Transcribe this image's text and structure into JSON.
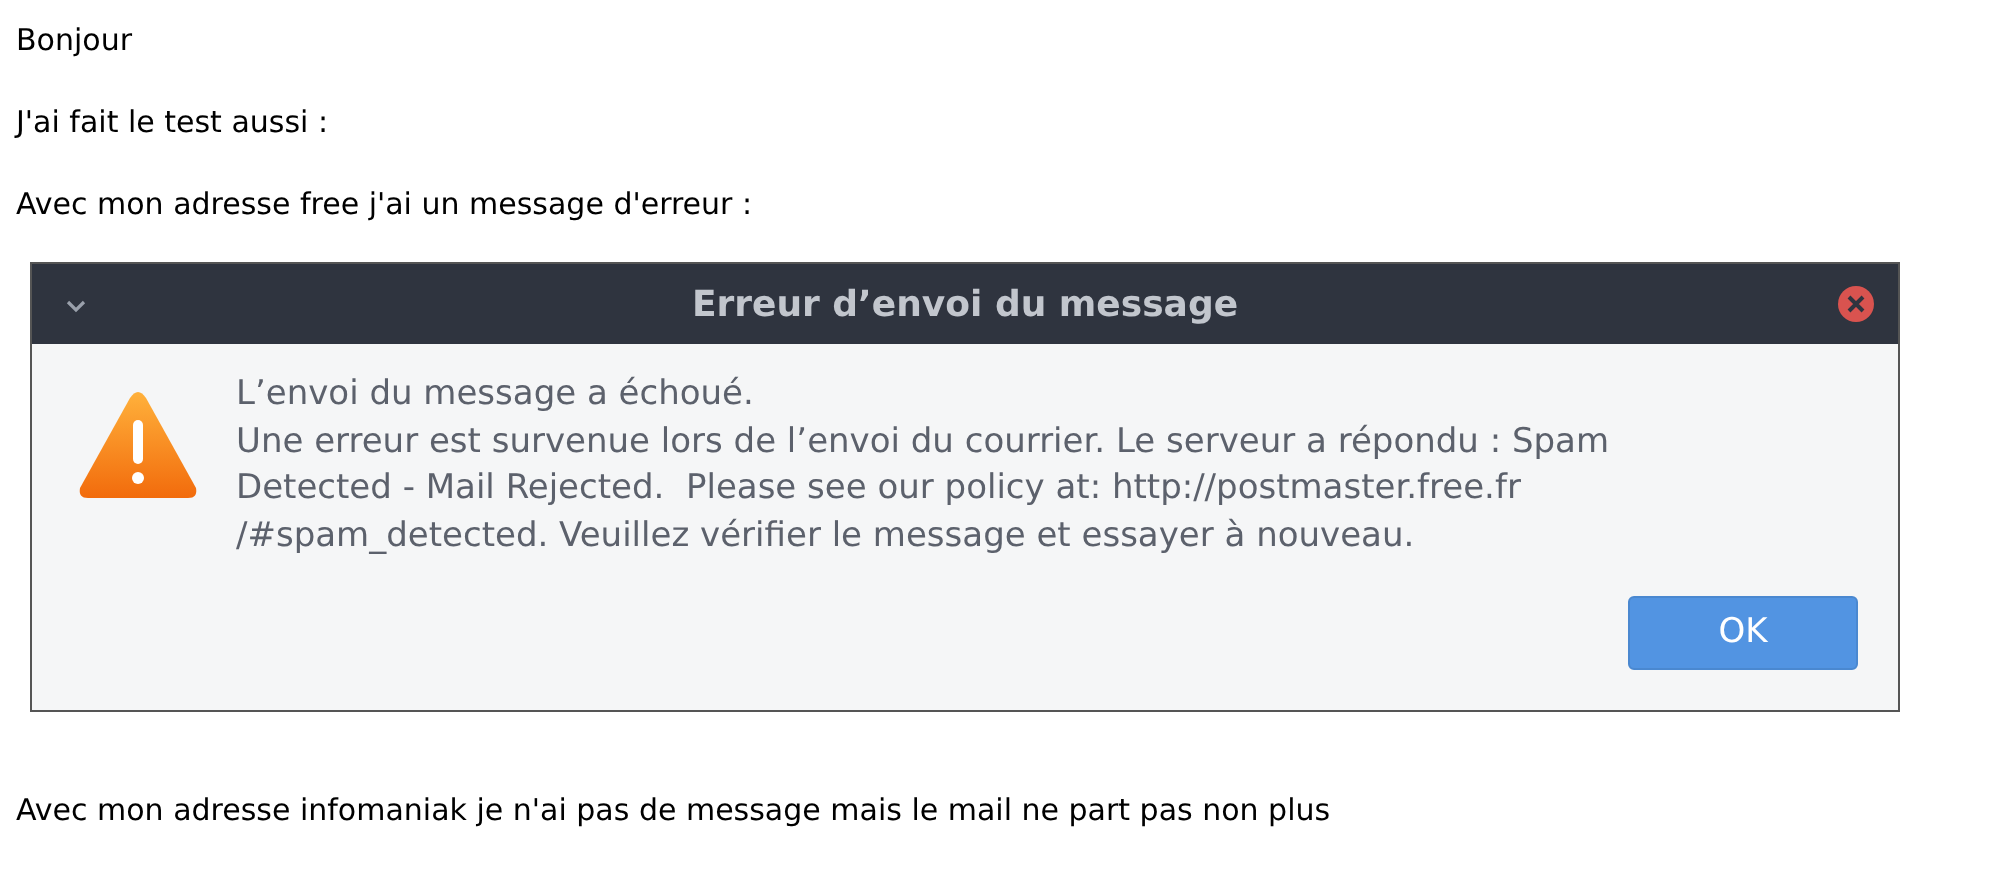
{
  "paragraphs_before": [
    "Bonjour",
    "J'ai fait le test aussi :",
    "Avec mon adresse free j'ai un message d'erreur :"
  ],
  "dialog": {
    "title": "Erreur d’envoi du message",
    "message_lines": [
      "L’envoi du message a échoué.",
      "Une erreur est survenue lors de l’envoi du courrier. Le serveur a répondu : Spam",
      "Detected - Mail Rejected.  Please see our policy at: http://postmaster.free.fr",
      "/#spam_detected. Veuillez vérifier le message et essayer à nouveau."
    ],
    "buttons": [
      "OK"
    ]
  },
  "paragraphs_after": [
    "Avec mon adresse infomaniak je n'ai pas de message mais le mail ne part pas non plus"
  ]
}
